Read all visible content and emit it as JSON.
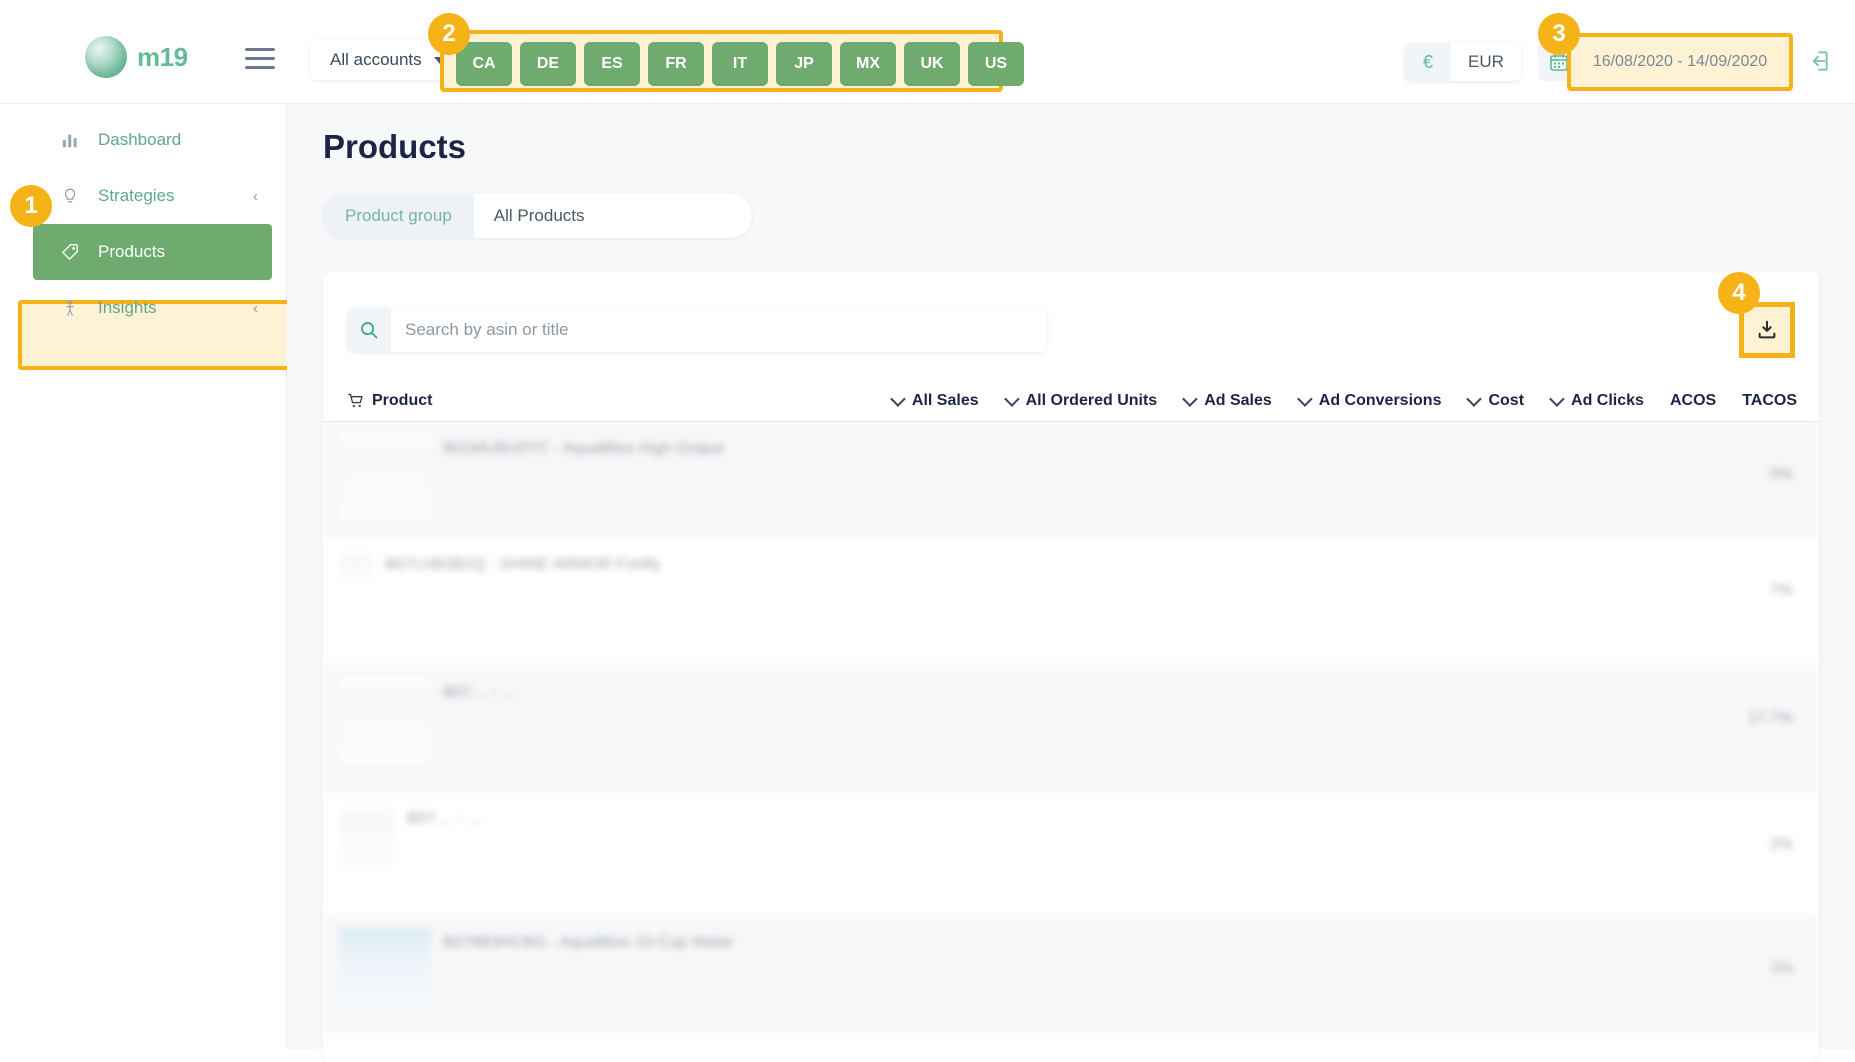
{
  "brand": {
    "name": "m19",
    "logo_icon": "sphere-logo"
  },
  "topbar": {
    "menu_icon": "hamburger-icon",
    "accounts_selector": {
      "label": "All accounts",
      "caret_icon": "caret-down-icon"
    },
    "marketplaces": [
      "CA",
      "DE",
      "ES",
      "FR",
      "IT",
      "JP",
      "MX",
      "UK",
      "US"
    ],
    "currency": {
      "symbol": "€",
      "code": "EUR"
    },
    "calendar_icon": "calendar-icon",
    "date_range": "16/08/2020 - 14/09/2020",
    "logout_icon": "logout-icon"
  },
  "sidebar": {
    "items": [
      {
        "label": "Dashboard",
        "icon": "bar-chart-icon",
        "active": false,
        "chevron": ""
      },
      {
        "label": "Strategies",
        "icon": "lightbulb-icon",
        "active": false,
        "chevron": "‹"
      },
      {
        "label": "Products",
        "icon": "tag-icon",
        "active": true,
        "chevron": ""
      },
      {
        "label": "Insights",
        "icon": "insights-icon",
        "active": false,
        "chevron": "‹"
      }
    ]
  },
  "main": {
    "page_title": "Products",
    "product_group": {
      "label": "Product group",
      "value": "All Products"
    },
    "search": {
      "placeholder": "Search by asin or title",
      "value": "",
      "icon": "search-icon"
    },
    "download_button": {
      "icon": "download-icon",
      "label": ""
    },
    "table": {
      "columns": [
        {
          "label": "Product",
          "sortable": false,
          "icon": "cart-icon"
        },
        {
          "label": "All Sales",
          "sortable": true
        },
        {
          "label": "All Ordered Units",
          "sortable": true
        },
        {
          "label": "Ad Sales",
          "sortable": true
        },
        {
          "label": "Ad Conversions",
          "sortable": true
        },
        {
          "label": "Cost",
          "sortable": true
        },
        {
          "label": "Ad Clicks",
          "sortable": true
        },
        {
          "label": "ACOS",
          "sortable": false
        },
        {
          "label": "TACOS",
          "sortable": false
        }
      ],
      "rows": [
        {
          "title": "B01MUBU0YC - AquaBliss High Output",
          "tacos": "0%",
          "thumb": "humidifier",
          "shaded": true
        },
        {
          "title": "B07LHB3B2Q - SHINE ARMOR Fortify",
          "tacos": "7%",
          "thumb": "spray-bottle",
          "shaded": false
        },
        {
          "title": "B07… - …",
          "tacos": "17.7%",
          "thumb": "product",
          "shaded": true
        },
        {
          "title": "B07… - …",
          "tacos": "2%",
          "thumb": "product",
          "shaded": false
        },
        {
          "title": "B078B3HCBG - AquaBliss 10-Cup Water",
          "tacos": "1%",
          "thumb": "water-pitcher",
          "shaded": true
        }
      ]
    }
  },
  "annotations": {
    "badges": [
      {
        "number": "1",
        "target": "sidebar-item-products"
      },
      {
        "number": "2",
        "target": "marketplace-buttons"
      },
      {
        "number": "3",
        "target": "date-range-field"
      },
      {
        "number": "4",
        "target": "download-button"
      }
    ],
    "highlight_color": "#f5b317",
    "highlight_fill": "#fdf3d4"
  },
  "colors": {
    "green": "#6faa6f",
    "teal": "#64bb96",
    "navy": "#1c2545",
    "amber": "#f5b317"
  }
}
